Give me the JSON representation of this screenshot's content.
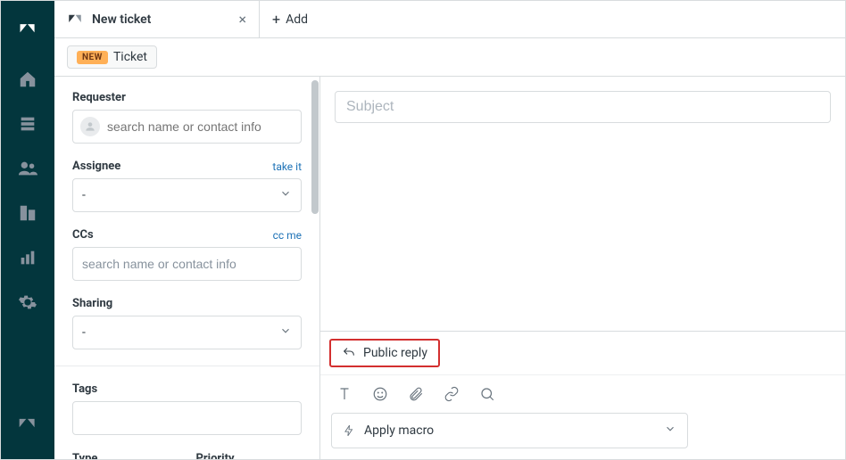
{
  "tabs": {
    "active": {
      "title": "New ticket"
    },
    "add_label": "Add"
  },
  "header": {
    "status_badge": "NEW",
    "status_text": "Ticket"
  },
  "sidebar": {
    "requester": {
      "label": "Requester",
      "placeholder": "search name or contact info"
    },
    "assignee": {
      "label": "Assignee",
      "take_it": "take it",
      "value": "-"
    },
    "ccs": {
      "label": "CCs",
      "cc_me": "cc me",
      "placeholder": "search name or contact info"
    },
    "sharing": {
      "label": "Sharing",
      "value": "-"
    },
    "tags": {
      "label": "Tags"
    },
    "type": {
      "label": "Type"
    },
    "priority": {
      "label": "Priority"
    }
  },
  "content": {
    "subject_placeholder": "Subject",
    "reply_mode": "Public reply",
    "macro_label": "Apply macro"
  }
}
